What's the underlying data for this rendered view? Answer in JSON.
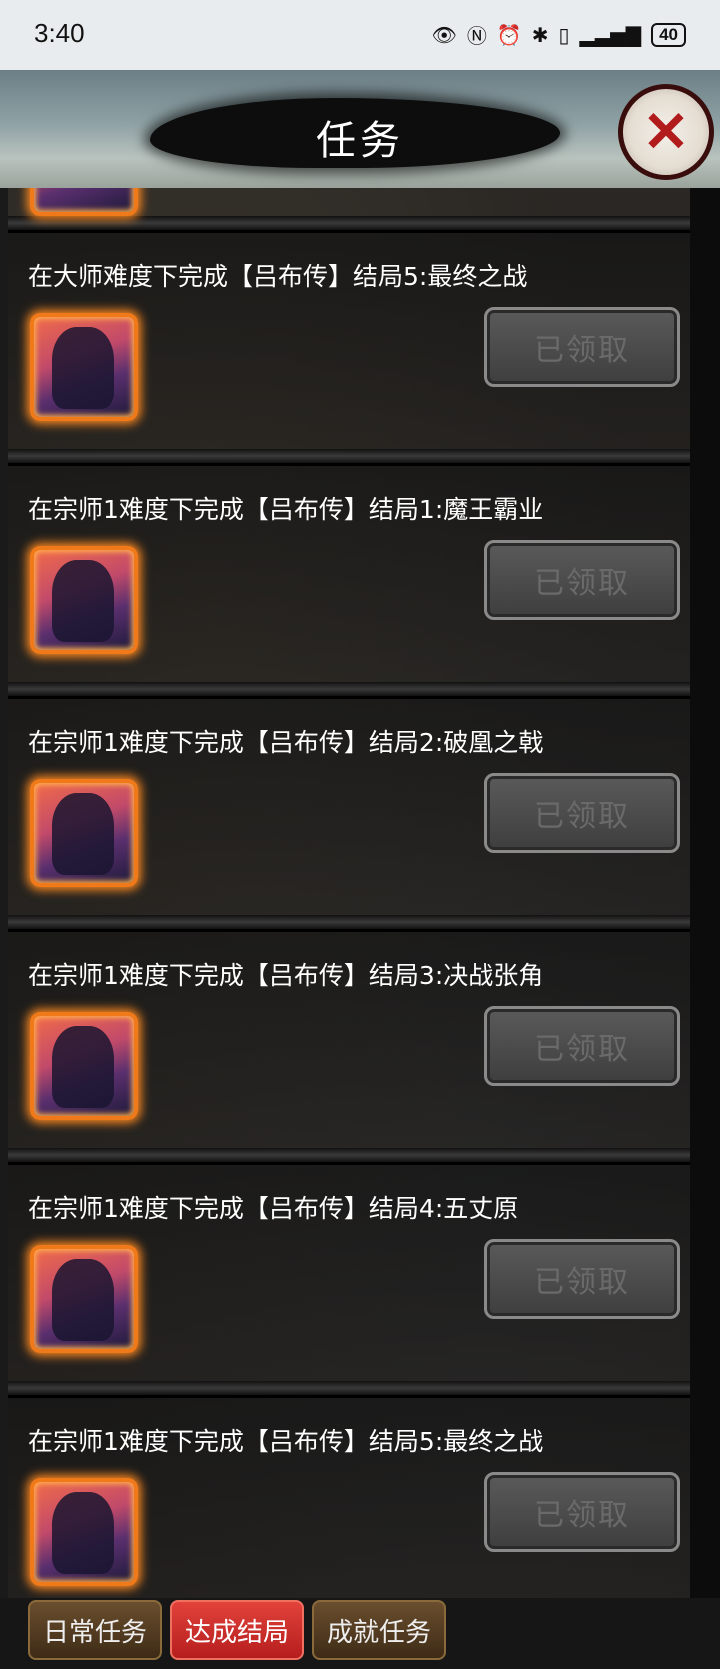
{
  "status": {
    "time": "3:40",
    "battery": "40"
  },
  "header": {
    "title": "任务"
  },
  "tasks": [
    {
      "desc": "在大师难度下完成【吕布传】结局5:最终之战",
      "button": "已领取"
    },
    {
      "desc": "在宗师1难度下完成【吕布传】结局1:魔王霸业",
      "button": "已领取"
    },
    {
      "desc": "在宗师1难度下完成【吕布传】结局2:破凰之戟",
      "button": "已领取"
    },
    {
      "desc": "在宗师1难度下完成【吕布传】结局3:决战张角",
      "button": "已领取"
    },
    {
      "desc": "在宗师1难度下完成【吕布传】结局4:五丈原",
      "button": "已领取"
    },
    {
      "desc": "在宗师1难度下完成【吕布传】结局5:最终之战",
      "button": "已领取"
    }
  ],
  "tabs": [
    {
      "label": "日常任务",
      "active": false
    },
    {
      "label": "达成结局",
      "active": true
    },
    {
      "label": "成就任务",
      "active": false
    }
  ]
}
